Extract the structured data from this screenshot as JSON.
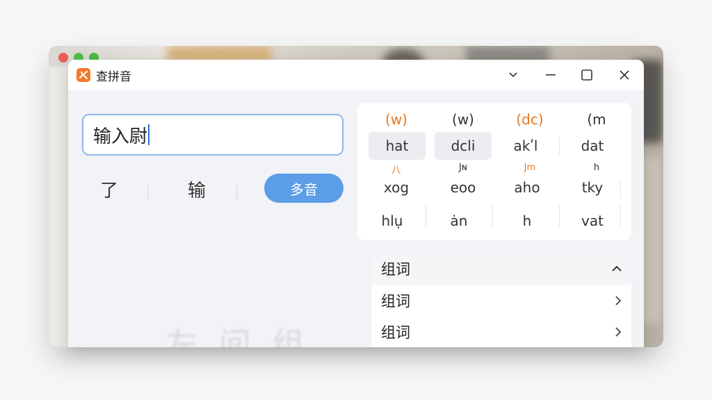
{
  "window": {
    "title": "查拼音",
    "controls": {
      "collapse": "⌄",
      "minimize": "–",
      "maximize": "☐",
      "close": "✕"
    }
  },
  "search": {
    "value": "输入尉"
  },
  "candidates": [
    "了",
    "输"
  ],
  "polyphone_button": "多音",
  "pinyin_grid": {
    "tones_row": [
      "(w)",
      "(w)",
      "(dc)",
      "(m"
    ],
    "row1": [
      "hat",
      "dcli",
      "akʹl",
      "dat"
    ],
    "mini_row": [
      "八",
      "Jɴ",
      "Jm",
      "h"
    ],
    "row2": [
      "xog",
      "eoo",
      "aho",
      "tky"
    ],
    "row3": [
      "hlụ",
      "ȧn",
      "h",
      "vat"
    ]
  },
  "words": {
    "header": "组词",
    "items": [
      "组词",
      "组词"
    ]
  },
  "ghost_text": "左 间 组"
}
